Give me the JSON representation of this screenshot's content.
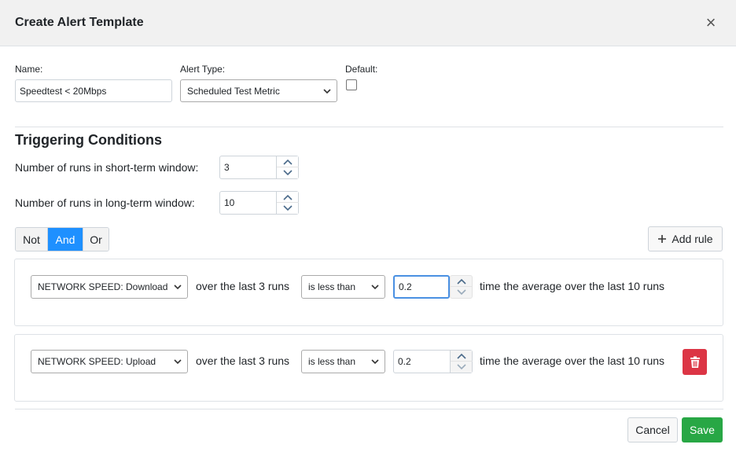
{
  "modal": {
    "title": "Create Alert Template",
    "close_glyph": "×"
  },
  "form": {
    "name_label": "Name:",
    "name_value": "Speedtest < 20Mbps",
    "alert_type_label": "Alert Type:",
    "alert_type_value": "Scheduled Test Metric",
    "default_label": "Default:",
    "default_checked": false
  },
  "triggering": {
    "title": "Triggering Conditions",
    "short_term_label": "Number of runs in short-term window:",
    "short_term_value": "3",
    "long_term_label": "Number of runs in long-term window:",
    "long_term_value": "10"
  },
  "logic": {
    "buttons": [
      "Not",
      "And",
      "Or"
    ],
    "active": "And",
    "add_rule_label": "Add rule"
  },
  "rules": [
    {
      "metric": "NETWORK SPEED: Download",
      "over_text": "over the last 3 runs",
      "comparator": "is less than",
      "value": "0.2",
      "tail_text": "time the average over the last 10 runs",
      "deletable": false
    },
    {
      "metric": "NETWORK SPEED: Upload",
      "over_text": "over the last 3 runs",
      "comparator": "is less than",
      "value": "0.2",
      "tail_text": "time the average over the last 10 runs",
      "deletable": true
    }
  ],
  "footer": {
    "cancel_label": "Cancel",
    "save_label": "Save"
  },
  "colors": {
    "accent": "#1e90ff",
    "save": "#28a745",
    "delete": "#dc3545",
    "header_bg": "#f1f1f1"
  },
  "icons": [
    "close-icon",
    "chevron-down-icon",
    "spinner-up-icon",
    "spinner-down-icon",
    "plus-icon",
    "trash-icon"
  ]
}
